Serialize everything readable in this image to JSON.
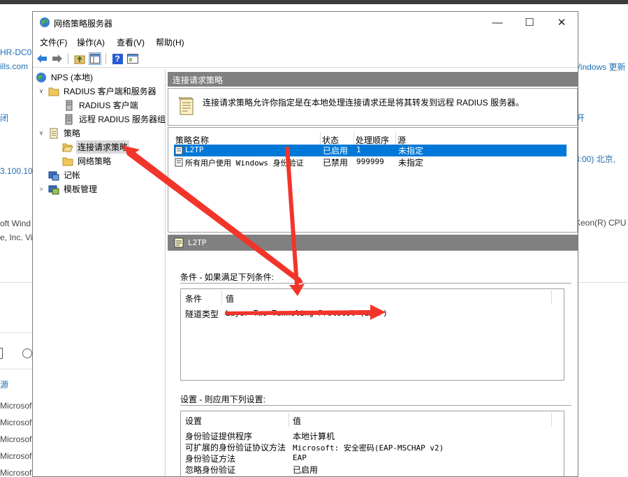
{
  "background": {
    "left_texts": [
      "HR-DC0",
      "ills.com",
      "闭",
      "3.100.10",
      "oft Wind",
      "e, Inc. Vi",
      "源",
      "Microsof",
      "Microsof",
      "Microsof",
      "Microsof",
      "Microsof"
    ],
    "right_texts": [
      "Vindows 更新",
      "开",
      "3:00) 北京,",
      "Xeon(R) CPU"
    ]
  },
  "window": {
    "title": "网络策略服务器",
    "minimize": "—",
    "maximize": "☐",
    "close": "✕"
  },
  "menu": {
    "file": "文件(F)",
    "action": "操作(A)",
    "view": "查看(V)",
    "help": "帮助(H)"
  },
  "toolbar": {
    "help_label": "?"
  },
  "tree": {
    "root": "NPS (本地)",
    "radius": "RADIUS 客户端和服务器",
    "radius_clients": "RADIUS 客户端",
    "remote_groups": "远程 RADIUS 服务器组",
    "policies": "策略",
    "conn_policies": "连接请求策略",
    "net_policies": "网络策略",
    "accounting": "记帐",
    "templates": "模板管理"
  },
  "content": {
    "header": "连接请求策略",
    "description": "连接请求策略允许你指定是在本地处理连接请求还是将其转发到远程 RADIUS 服务器。",
    "columns": [
      "策略名称",
      "状态",
      "处理顺序",
      "源"
    ],
    "rows": [
      {
        "name": "L2TP",
        "status": "已启用",
        "order": "1",
        "source": "未指定",
        "selected": true
      },
      {
        "name": "所有用户使用 Windows 身份验证",
        "status": "已禁用",
        "order": "999999",
        "source": "未指定",
        "selected": false
      }
    ],
    "detail_title": "L2TP",
    "conditions_label": "条件 - 如果满足下列条件:",
    "conditions_columns": [
      "条件",
      "值"
    ],
    "conditions": [
      {
        "condition": "隧道类型",
        "value": "Layer Two Tunneling Protocol (L2TP)"
      }
    ],
    "settings_label": "设置 - 则应用下列设置:",
    "settings_columns": [
      "设置",
      "值"
    ],
    "settings": [
      {
        "setting": "身份验证提供程序",
        "value": "本地计算机"
      },
      {
        "setting": "可扩展的身份验证协议方法",
        "value": "Microsoft: 安全密码(EAP-MSCHAP v2)"
      },
      {
        "setting": "身份验证方法",
        "value": "EAP"
      },
      {
        "setting": "忽略身份验证",
        "value": "已启用"
      }
    ]
  },
  "colors": {
    "selection": "#0078d7",
    "header_bar": "#808080",
    "annotation_arrow": "#f2352b",
    "link_blue": "#1f6fb3"
  }
}
